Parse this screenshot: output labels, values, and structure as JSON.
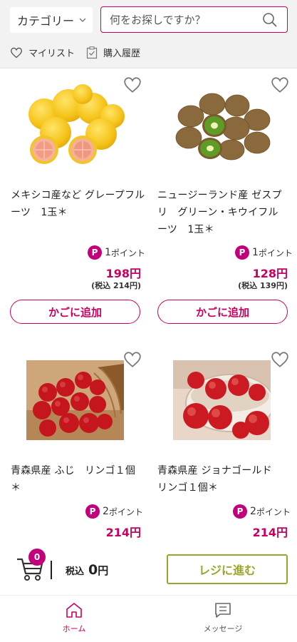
{
  "header": {
    "category_label": "カテゴリー",
    "search_placeholder": "何をお探しですか？",
    "mylist_label": "マイリスト",
    "history_label": "購入履歴"
  },
  "products": [
    {
      "name_line1": "メキシコ産など グレープフル",
      "name_line2": "ーツ　1玉＊",
      "name_line3": "",
      "points": "1",
      "points_suffix": "ポイント",
      "price": "198円",
      "tax_included": "(税込 214円)",
      "add_label": "かごに追加",
      "image": "grapefruit"
    },
    {
      "name_line1": "ニュージーランド産 ゼスプ",
      "name_line2": "リ　グリーン・キウイフル",
      "name_line3": "ーツ　1玉＊",
      "points": "1",
      "points_suffix": "ポイント",
      "price": "128円",
      "tax_included": "(税込 139円)",
      "add_label": "かごに追加",
      "image": "kiwi"
    },
    {
      "name_line1": "青森県産 ふじ　リンゴ１個",
      "name_line2": "＊",
      "name_line3": "",
      "points": "2",
      "points_suffix": "ポイント",
      "price": "214円",
      "tax_included": "",
      "add_label": "",
      "image": "apple-fuji"
    },
    {
      "name_line1": "青森県産 ジョナゴールド",
      "name_line2": "リンゴ１個＊",
      "name_line3": "",
      "points": "2",
      "points_suffix": "ポイント",
      "price": "214円",
      "tax_included": "",
      "add_label": "",
      "image": "apple-jonagold"
    }
  ],
  "cart": {
    "count": "0",
    "tax_label": "税込",
    "total": "0",
    "yen": "円",
    "checkout_label": "レジに進む"
  },
  "tabs": [
    {
      "label": "ホーム",
      "icon": "home-icon",
      "active": true
    },
    {
      "label": "メッセージ",
      "icon": "message-icon",
      "active": false
    }
  ],
  "colors": {
    "accent": "#c9005e",
    "points_badge": "#c1007a",
    "checkout": "#9aa52a"
  }
}
